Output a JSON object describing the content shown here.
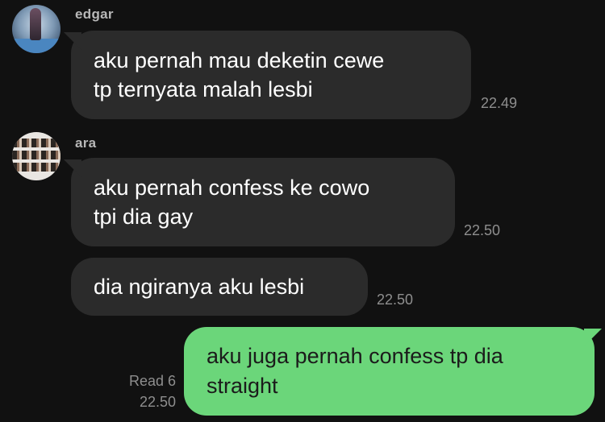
{
  "messages": [
    {
      "sender": "edgar",
      "lines": [
        "aku pernah mau deketin cewe",
        "tp ternyata malah lesbi"
      ],
      "time": "22.49"
    },
    {
      "sender": "ara",
      "lines": [
        "aku pernah confess ke cowo",
        "tpi dia gay"
      ],
      "time": "22.50"
    },
    {
      "sender": "ara",
      "lines": [
        "dia ngiranya aku lesbi"
      ],
      "time": "22.50"
    },
    {
      "sender": "me",
      "lines": [
        "aku juga pernah confess tp dia",
        "straight"
      ],
      "time": "22.50",
      "read_status": "Read 6"
    }
  ],
  "colors": {
    "background": "#111111",
    "incoming_bubble": "#2b2b2b",
    "outgoing_bubble": "#6bd67a",
    "timestamp": "#8e8e8e"
  },
  "icons": {
    "edgar_avatar": "edgar-avatar-photo",
    "ara_avatar": "ara-avatar-photo"
  }
}
